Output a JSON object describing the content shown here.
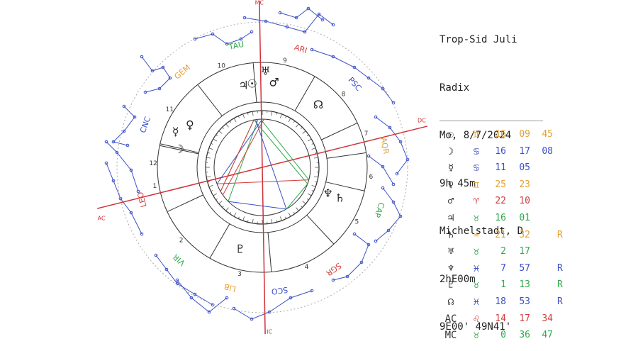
{
  "header": {
    "system": "Trop-Sid Juli",
    "chart_type": "Radix",
    "date": "Mo, 8/7/2024",
    "time": "9h 45m",
    "place": "Michelstadt, D",
    "timezone": "2hE00m",
    "coords": "9E00' 49N41'"
  },
  "axes": {
    "mc": "MC",
    "ic": "IC",
    "ac": "AC",
    "dc": "DC"
  },
  "constellations": [
    {
      "label": "ARI",
      "color": "#d23c3c"
    },
    {
      "label": "PSC",
      "color": "#3a4ec8"
    },
    {
      "label": "AQR",
      "color": "#e2a032"
    },
    {
      "label": "CAP",
      "color": "#2fa84a"
    },
    {
      "label": "SGR",
      "color": "#d23c3c"
    },
    {
      "label": "SCO",
      "color": "#3a4ec8"
    },
    {
      "label": "LIB",
      "color": "#e2a032"
    },
    {
      "label": "VIR",
      "color": "#2fa84a"
    },
    {
      "label": "LEO",
      "color": "#d23c3c"
    },
    {
      "label": "CNC",
      "color": "#3a4ec8"
    },
    {
      "label": "GEM",
      "color": "#e2a032"
    },
    {
      "label": "TAU",
      "color": "#2fa84a"
    }
  ],
  "house_numbers": [
    "1",
    "2",
    "3",
    "4",
    "5",
    "6",
    "7",
    "8",
    "9",
    "10",
    "11",
    "12"
  ],
  "chart_planets": [
    {
      "glyph": "☉",
      "name": "sun"
    },
    {
      "glyph": "☽",
      "name": "moon"
    },
    {
      "glyph": "☿",
      "name": "mercury"
    },
    {
      "glyph": "♀",
      "name": "venus"
    },
    {
      "glyph": "♂",
      "name": "mars"
    },
    {
      "glyph": "♃",
      "name": "jupiter"
    },
    {
      "glyph": "♄",
      "name": "saturn"
    },
    {
      "glyph": "♅",
      "name": "uranus"
    },
    {
      "glyph": "♆",
      "name": "neptune"
    },
    {
      "glyph": "♇",
      "name": "pluto"
    },
    {
      "glyph": "☊",
      "name": "node"
    }
  ],
  "positions": [
    {
      "planet": "☉",
      "sign": "♊",
      "sign_color": "#e2a032",
      "deg": "16",
      "min": "09",
      "sec": "45",
      "retro": "",
      "color": "#e2a032"
    },
    {
      "planet": "☽",
      "sign": "♋",
      "sign_color": "#3a4ec8",
      "deg": "16",
      "min": "17",
      "sec": "08",
      "retro": "",
      "color": "#3a4ec8"
    },
    {
      "planet": "☿",
      "sign": "♋",
      "sign_color": "#3a4ec8",
      "deg": "11",
      "min": "05",
      "sec": "",
      "retro": "",
      "color": "#3a4ec8"
    },
    {
      "planet": "♀",
      "sign": "♊",
      "sign_color": "#e2a032",
      "deg": "25",
      "min": "23",
      "sec": "",
      "retro": "",
      "color": "#e2a032"
    },
    {
      "planet": "♂",
      "sign": "♈",
      "sign_color": "#d23c3c",
      "deg": "22",
      "min": "10",
      "sec": "",
      "retro": "",
      "color": "#d23c3c"
    },
    {
      "planet": "♃",
      "sign": "♉",
      "sign_color": "#2fa84a",
      "deg": "16",
      "min": "01",
      "sec": "",
      "retro": "",
      "color": "#2fa84a"
    },
    {
      "planet": "♄",
      "sign": "♒",
      "sign_color": "#e2a032",
      "deg": "21",
      "min": "32",
      "sec": "",
      "retro": "R",
      "color": "#e2a032"
    },
    {
      "planet": "♅",
      "sign": "♉",
      "sign_color": "#2fa84a",
      "deg": "2",
      "min": "17",
      "sec": "",
      "retro": "",
      "color": "#2fa84a"
    },
    {
      "planet": "♆",
      "sign": "♓",
      "sign_color": "#3a4ec8",
      "deg": "7",
      "min": "57",
      "sec": "",
      "retro": "R",
      "color": "#3a4ec8"
    },
    {
      "planet": "♇",
      "sign": "♉",
      "sign_color": "#2fa84a",
      "deg": "1",
      "min": "13",
      "sec": "",
      "retro": "R",
      "color": "#2fa84a"
    },
    {
      "planet": "☊",
      "sign": "♓",
      "sign_color": "#3a4ec8",
      "deg": "18",
      "min": "53",
      "sec": "",
      "retro": "R",
      "color": "#3a4ec8"
    },
    {
      "planet": "AC",
      "sign": "♌",
      "sign_color": "#d23c3c",
      "deg": "14",
      "min": "17",
      "sec": "34",
      "retro": "",
      "color": "#d23c3c"
    },
    {
      "planet": "MC",
      "sign": "♉",
      "sign_color": "#2fa84a",
      "deg": "0",
      "min": "36",
      "sec": "47",
      "retro": "",
      "color": "#2fa84a"
    }
  ],
  "colors": {
    "axis": "#d0303a",
    "constellation_lines": "#3a4ec8",
    "house_lines": "#333333",
    "aspect_green": "#2fa84a",
    "aspect_blue": "#3a4ec8",
    "aspect_red": "#d23c3c"
  }
}
